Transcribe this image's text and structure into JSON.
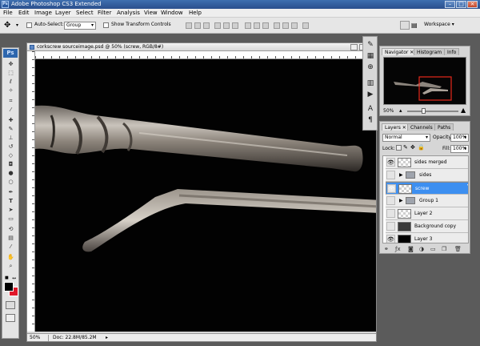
{
  "app": {
    "title": "Adobe Photoshop CS3 Extended",
    "logo": "Ps"
  },
  "menu": [
    "File",
    "Edit",
    "Image",
    "Layer",
    "Select",
    "Filter",
    "Analysis",
    "View",
    "Window",
    "Help"
  ],
  "options": {
    "auto_select_label": "Auto-Select:",
    "auto_select_value": "Group",
    "show_transform_label": "Show Transform Controls",
    "workspace_label": "Workspace"
  },
  "document": {
    "title": "corkscrew sourceimage.psd @ 50% (screw, RGB/8#)",
    "zoom": "50%",
    "doc_info": "Doc: 22.8M/85.2M"
  },
  "navigator": {
    "tabs": [
      "Navigator",
      "Histogram",
      "Info"
    ],
    "zoom": "50%"
  },
  "layers_panel": {
    "tabs": [
      "Layers",
      "Channels",
      "Paths"
    ],
    "blend_mode": "Normal",
    "opacity_label": "Opacity:",
    "opacity_value": "100%",
    "lock_label": "Lock:",
    "fill_label": "Fill:",
    "fill_value": "100%",
    "layers": [
      {
        "name": "sides merged",
        "visible": true,
        "type": "pixel",
        "selected": false
      },
      {
        "name": "sides",
        "visible": false,
        "type": "group",
        "selected": false
      },
      {
        "name": "screw",
        "visible": true,
        "type": "pixel",
        "selected": true
      },
      {
        "name": "Group 1",
        "visible": false,
        "type": "group",
        "selected": false
      },
      {
        "name": "Layer 2",
        "visible": false,
        "type": "pixel",
        "selected": false
      },
      {
        "name": "Background copy",
        "visible": false,
        "type": "pixel",
        "selected": false
      },
      {
        "name": "Layer 3",
        "visible": true,
        "type": "fill",
        "selected": false
      }
    ]
  },
  "colors": {
    "selection": "#3d8ff0",
    "foreground": "#000000",
    "background": "#e0182a"
  }
}
